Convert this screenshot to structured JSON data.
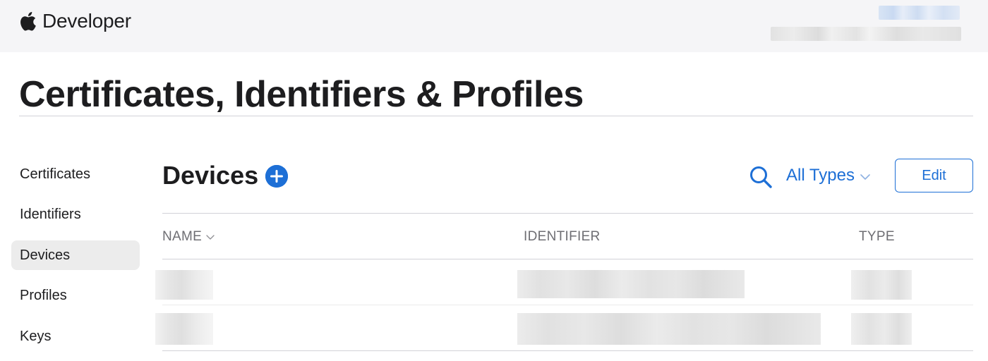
{
  "header": {
    "logo_icon": "apple-logo-icon",
    "brand": "Developer"
  },
  "page": {
    "title": "Certificates, Identifiers & Profiles"
  },
  "sidebar": {
    "items": [
      {
        "label": "Certificates",
        "active": false
      },
      {
        "label": "Identifiers",
        "active": false
      },
      {
        "label": "Devices",
        "active": true
      },
      {
        "label": "Profiles",
        "active": false
      },
      {
        "label": "Keys",
        "active": false
      }
    ]
  },
  "main": {
    "title": "Devices",
    "add_icon": "plus-circle-icon",
    "search_icon": "search-icon",
    "filter": {
      "selected": "All Types",
      "icon": "chevron-down-icon"
    },
    "edit_label": "Edit"
  },
  "table": {
    "columns": [
      {
        "label": "NAME",
        "sortable": true
      },
      {
        "label": "IDENTIFIER",
        "sortable": false
      },
      {
        "label": "TYPE",
        "sortable": false
      }
    ],
    "rows": [
      {
        "redacted": true
      },
      {
        "redacted": true
      }
    ]
  },
  "colors": {
    "accent": "#1d6fd6",
    "text": "#1d1d1f",
    "muted": "#6e6e73",
    "topbar_bg": "#f5f5f7",
    "active_bg": "#ececec",
    "divider": "#d2d2d7"
  }
}
